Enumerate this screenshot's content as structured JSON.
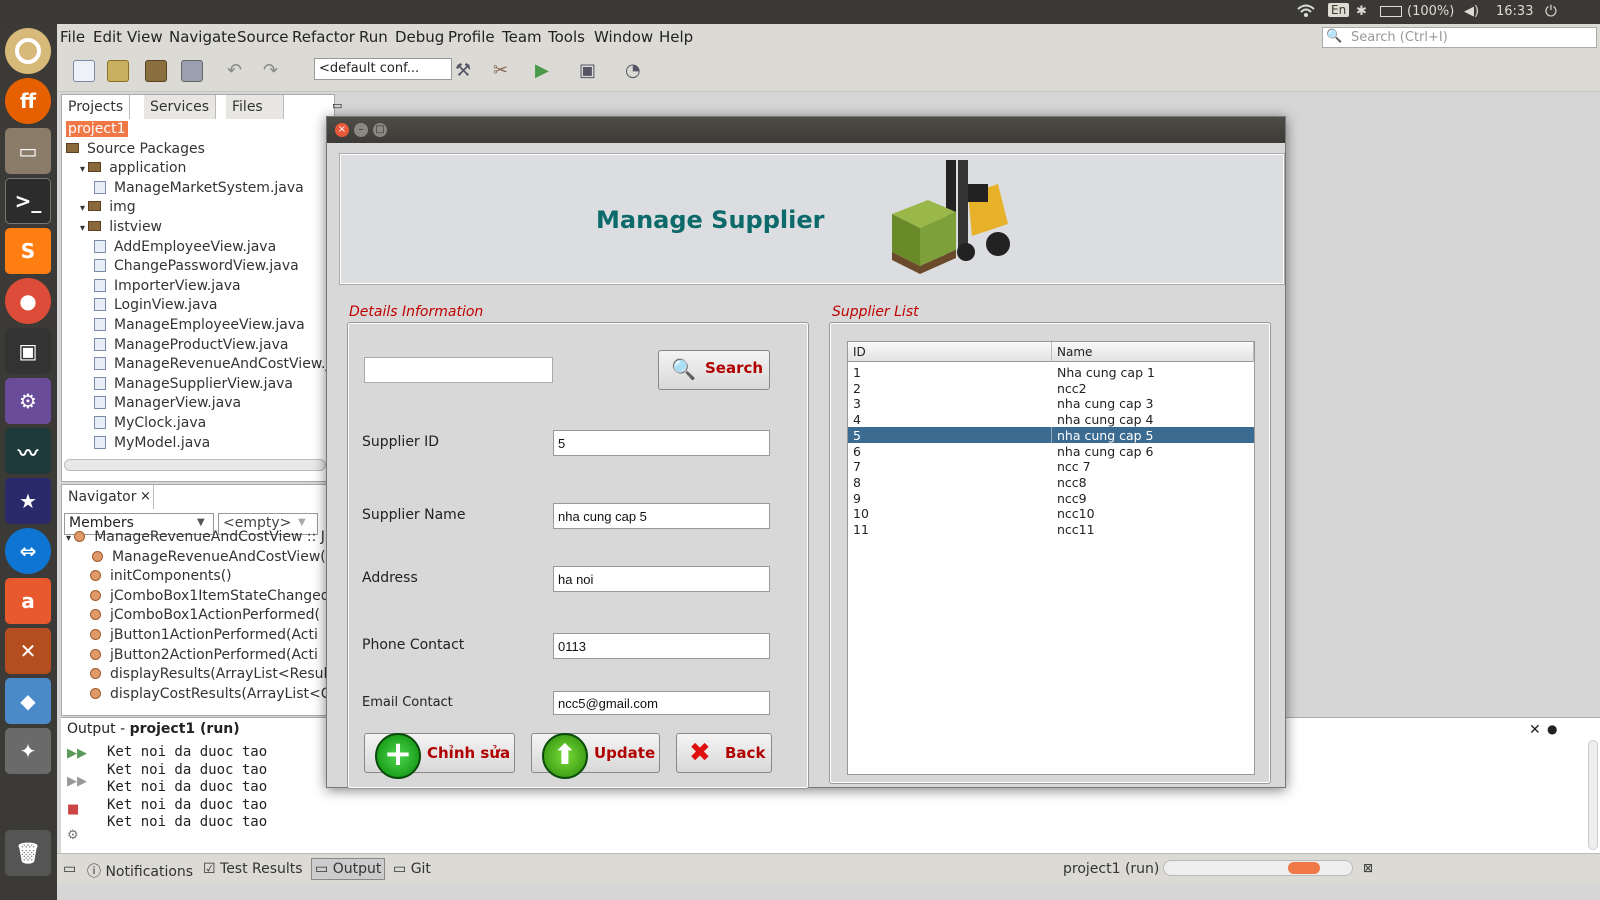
{
  "topbar": {
    "lang": "En",
    "battery": "(100%)",
    "time": "16:33"
  },
  "menubar": {
    "items": [
      "File",
      "Edit",
      "View",
      "Navigate",
      "Source",
      "Refactor",
      "Run",
      "Debug",
      "Profile",
      "Team",
      "Tools",
      "Window",
      "Help"
    ],
    "search_placeholder": "Search (Ctrl+I)"
  },
  "toolbar": {
    "config": "<default conf..."
  },
  "projects": {
    "tabs": [
      "Projects",
      "Services",
      "Files"
    ],
    "tree": [
      {
        "label": "project1",
        "level": 0,
        "selected": true
      },
      {
        "label": "Source Packages",
        "level": 0
      },
      {
        "label": "application",
        "level": 1
      },
      {
        "label": "ManageMarketSystem.java",
        "level": 2
      },
      {
        "label": "img",
        "level": 1
      },
      {
        "label": "listview",
        "level": 1
      },
      {
        "label": "AddEmployeeView.java",
        "level": 2
      },
      {
        "label": "ChangePasswordView.java",
        "level": 2
      },
      {
        "label": "ImporterView.java",
        "level": 2
      },
      {
        "label": "LoginView.java",
        "level": 2
      },
      {
        "label": "ManageEmployeeView.java",
        "level": 2
      },
      {
        "label": "ManageProductView.java",
        "level": 2
      },
      {
        "label": "ManageRevenueAndCostView.j",
        "level": 2
      },
      {
        "label": "ManageSupplierView.java",
        "level": 2
      },
      {
        "label": "ManagerView.java",
        "level": 2
      },
      {
        "label": "MyClock.java",
        "level": 2
      },
      {
        "label": "MyModel.java",
        "level": 2
      }
    ]
  },
  "navigator": {
    "title": "Navigator",
    "members": "Members",
    "filter": "<empty>",
    "items": [
      "ManageRevenueAndCostView :: J",
      "ManageRevenueAndCostView()",
      "initComponents()",
      "jComboBox1ItemStateChanged",
      "jComboBox1ActionPerformed(",
      "jButton1ActionPerformed(Acti",
      "jButton2ActionPerformed(Acti",
      "displayResults(ArrayList<Result",
      "displayCostResults(ArrayList<C"
    ]
  },
  "output": {
    "title": "Output - ",
    "project": "project1 (run)",
    "lines": [
      "Ket noi da duoc tao",
      "Ket noi da duoc tao",
      "Ket noi da duoc tao",
      "Ket noi da duoc tao",
      "Ket noi da duoc tao"
    ]
  },
  "statusbar": {
    "notifications": "Notifications",
    "test_results": "Test Results",
    "output": "Output",
    "git": "Git",
    "run_status": "project1 (run)"
  },
  "dialog": {
    "title": "Manage Supplier",
    "details_title": "Details Information",
    "list_title": "Supplier List",
    "search_value": "",
    "search_button": "Search",
    "fields": [
      {
        "label": "Supplier ID",
        "value": "5"
      },
      {
        "label": "Supplier Name",
        "value": "nha cung cap 5"
      },
      {
        "label": "Address",
        "value": "ha noi"
      },
      {
        "label": "Phone Contact",
        "value": "0113"
      },
      {
        "label": "Email Contact",
        "value": "ncc5@gmail.com"
      }
    ],
    "buttons": {
      "edit": "Chỉnh sửa",
      "update": "Update",
      "back": "Back"
    },
    "table": {
      "headers": [
        "ID",
        "Name"
      ],
      "rows": [
        [
          "1",
          "Nha cung cap 1"
        ],
        [
          "2",
          "ncc2"
        ],
        [
          "3",
          "nha cung cap 3"
        ],
        [
          "4",
          "nha cung cap 4"
        ],
        [
          "5",
          "nha cung cap 5"
        ],
        [
          "6",
          "nha cung cap 6"
        ],
        [
          "7",
          "ncc 7"
        ],
        [
          "8",
          "ncc8"
        ],
        [
          "9",
          "ncc9"
        ],
        [
          "10",
          "ncc10"
        ],
        [
          "11",
          "ncc11"
        ]
      ],
      "selected_row": 4
    }
  },
  "colors": {
    "accent": "#0c6a6a",
    "selection": "#3c6b91",
    "group_title": "#c00000",
    "project_highlight": "#f07746"
  }
}
